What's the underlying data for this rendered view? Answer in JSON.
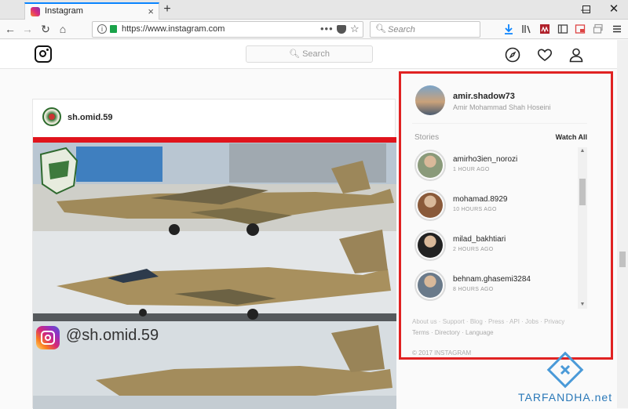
{
  "browser": {
    "tab": {
      "title": "Instagram"
    },
    "url": "https://www.instagram.com",
    "search_placeholder": "Search"
  },
  "instagram": {
    "search_placeholder": "Search",
    "post": {
      "username": "sh.omid.59",
      "watermark": "@sh.omid.59"
    },
    "current_user": {
      "username": "amir.shadow73",
      "full_name": "Amir Mohammad Shah Hoseini"
    },
    "stories": {
      "label": "Stories",
      "watch_all": "Watch All",
      "items": [
        {
          "username": "amirho3ien_norozi",
          "time": "1 HOUR AGO",
          "color": "#8a9a7a"
        },
        {
          "username": "mohamad.8929",
          "time": "10 HOURS AGO",
          "color": "#8a5a3a"
        },
        {
          "username": "milad_bakhtiari",
          "time": "2 HOURS AGO",
          "color": "#222222"
        },
        {
          "username": "behnam.ghasemi3284",
          "time": "8 HOURS AGO",
          "color": "#6a7a8a"
        }
      ]
    },
    "footer": {
      "links_row1": "About us · Support · Blog · Press · API · Jobs · Privacy",
      "links_row2": "Terms · Directory · Language",
      "copyright": "© 2017 INSTAGRAM"
    }
  },
  "brand": {
    "name": "TARFANDHA.net"
  },
  "colors": {
    "highlight": "#e02222",
    "browser_accent": "#0a84ff"
  }
}
